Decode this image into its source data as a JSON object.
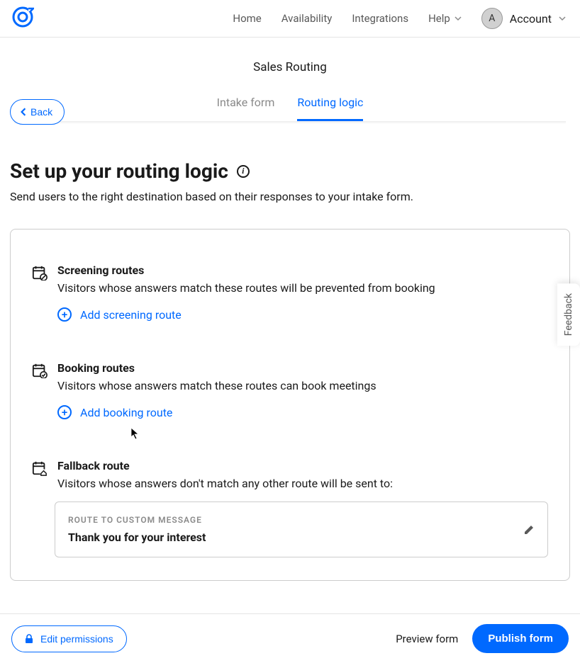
{
  "nav": {
    "home": "Home",
    "availability": "Availability",
    "integrations": "Integrations",
    "help": "Help",
    "account": "Account",
    "avatar_initial": "A"
  },
  "subheader": {
    "back": "Back",
    "page_title": "Sales Routing",
    "tabs": {
      "intake": "Intake form",
      "routing": "Routing logic"
    }
  },
  "main": {
    "heading": "Set up your routing logic",
    "subtext": "Send users to the right destination based on their responses to your intake form.",
    "screening": {
      "title": "Screening routes",
      "desc": "Visitors whose answers match these routes will be prevented from booking",
      "add": "Add screening route"
    },
    "booking": {
      "title": "Booking routes",
      "desc": "Visitors whose answers match these routes can book meetings",
      "add": "Add booking route"
    },
    "fallback": {
      "title": "Fallback route",
      "desc": "Visitors whose answers don't match any other route will be sent to:",
      "box_label": "ROUTE TO CUSTOM MESSAGE",
      "box_value": "Thank you for your interest"
    }
  },
  "feedback": "Feedback",
  "footer": {
    "edit_permissions": "Edit permissions",
    "preview": "Preview form",
    "publish": "Publish form"
  }
}
